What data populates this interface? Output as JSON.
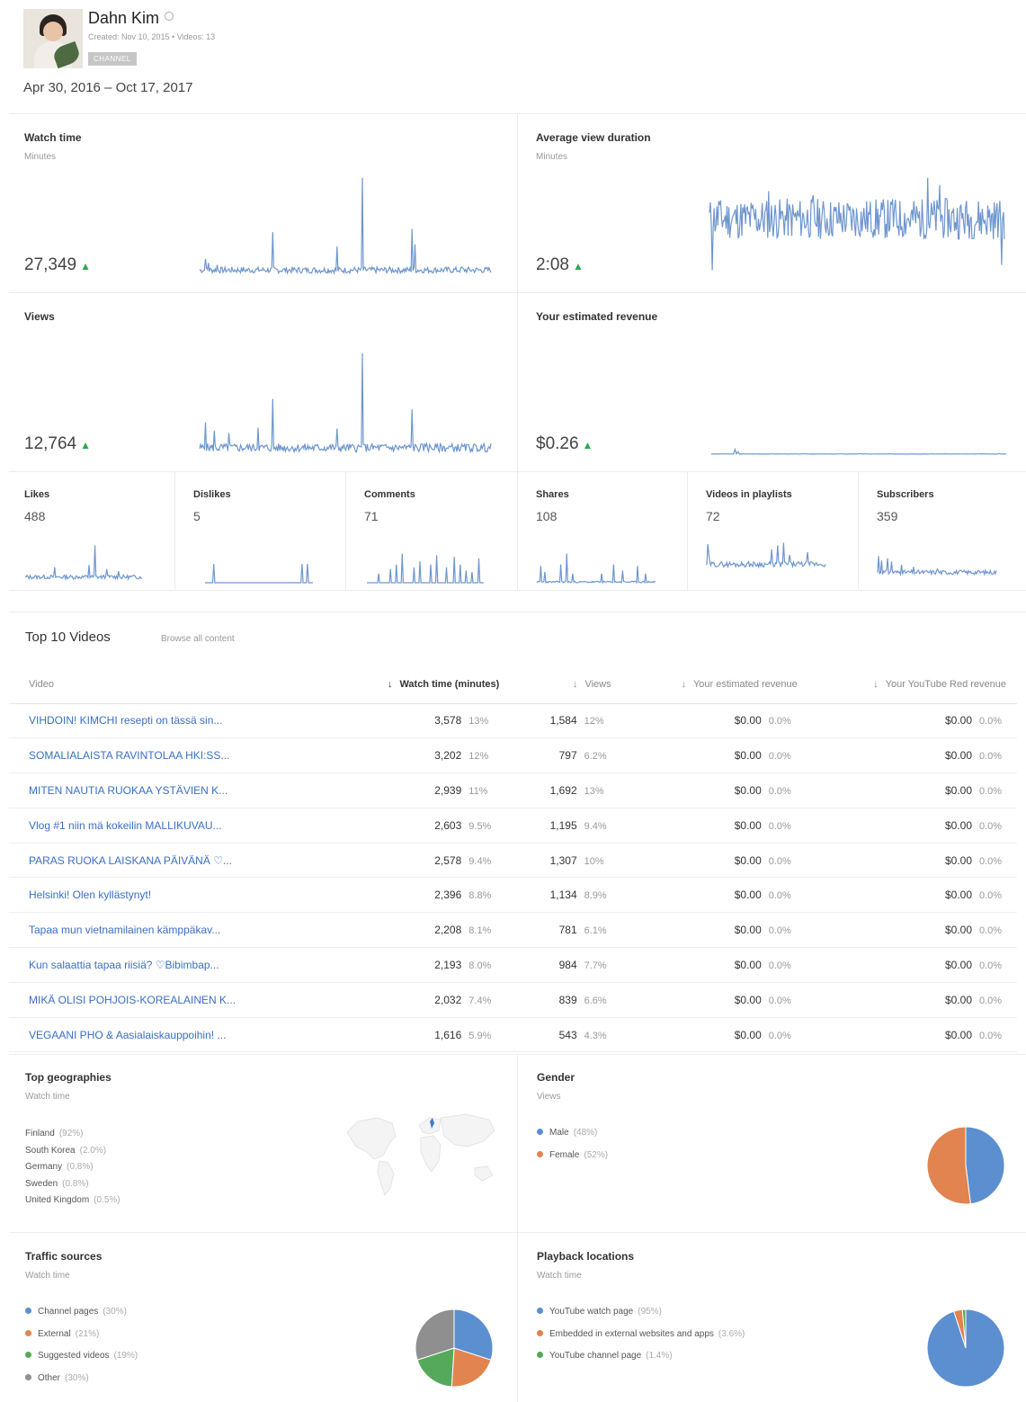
{
  "channel": {
    "name": "Dahn Kim",
    "meta": "Created: Nov 10, 2015  •  Videos: 13",
    "badge": "CHANNEL",
    "date_range": "Apr 30, 2016 – Oct 17, 2017"
  },
  "metrics": {
    "watch_time": {
      "title": "Watch time",
      "sub": "Minutes",
      "value": "27,349"
    },
    "avg_view_duration": {
      "title": "Average view duration",
      "sub": "Minutes",
      "value": "2:08"
    },
    "views": {
      "title": "Views",
      "value": "12,764"
    },
    "revenue": {
      "title": "Your estimated revenue",
      "value": "$0.26"
    }
  },
  "small_metrics": [
    {
      "title": "Likes",
      "value": "488"
    },
    {
      "title": "Dislikes",
      "value": "5"
    },
    {
      "title": "Comments",
      "value": "71"
    },
    {
      "title": "Shares",
      "value": "108"
    },
    {
      "title": "Videos in playlists",
      "value": "72"
    },
    {
      "title": "Subscribers",
      "value": "359"
    }
  ],
  "top_videos": {
    "title": "Top 10 Videos",
    "browse": "Browse all content",
    "headers": [
      "Video",
      "Watch time (minutes)",
      "Views",
      "Your estimated revenue",
      "Your YouTube Red revenue"
    ],
    "rows": [
      {
        "video": "VIHDOIN! KIMCHI resepti on tässä sin...",
        "watch": "3,578",
        "watch_pct": "13%",
        "views": "1,584",
        "views_pct": "12%",
        "rev": "$0.00",
        "rev_pct": "0.0%",
        "red": "$0.00",
        "red_pct": "0.0%"
      },
      {
        "video": "SOMALIALAISTA RAVINTOLAA HKI:SS...",
        "watch": "3,202",
        "watch_pct": "12%",
        "views": "797",
        "views_pct": "6.2%",
        "rev": "$0.00",
        "rev_pct": "0.0%",
        "red": "$0.00",
        "red_pct": "0.0%"
      },
      {
        "video": "MITEN NAUTIA RUOKAA YSTÄVIEN K...",
        "watch": "2,939",
        "watch_pct": "11%",
        "views": "1,692",
        "views_pct": "13%",
        "rev": "$0.00",
        "rev_pct": "0.0%",
        "red": "$0.00",
        "red_pct": "0.0%"
      },
      {
        "video": "Vlog #1 niin mä kokeilin MALLIKUVAU...",
        "watch": "2,603",
        "watch_pct": "9.5%",
        "views": "1,195",
        "views_pct": "9.4%",
        "rev": "$0.00",
        "rev_pct": "0.0%",
        "red": "$0.00",
        "red_pct": "0.0%"
      },
      {
        "video": "PARAS RUOKA LAISKANA PÄIVÄNÄ ♡...",
        "watch": "2,578",
        "watch_pct": "9.4%",
        "views": "1,307",
        "views_pct": "10%",
        "rev": "$0.00",
        "rev_pct": "0.0%",
        "red": "$0.00",
        "red_pct": "0.0%"
      },
      {
        "video": "Helsinki! Olen kyllästynyt!",
        "watch": "2,396",
        "watch_pct": "8.8%",
        "views": "1,134",
        "views_pct": "8.9%",
        "rev": "$0.00",
        "rev_pct": "0.0%",
        "red": "$0.00",
        "red_pct": "0.0%"
      },
      {
        "video": "Tapaa mun vietnamilainen kämppäkav...",
        "watch": "2,208",
        "watch_pct": "8.1%",
        "views": "781",
        "views_pct": "6.1%",
        "rev": "$0.00",
        "rev_pct": "0.0%",
        "red": "$0.00",
        "red_pct": "0.0%"
      },
      {
        "video": "Kun salaattia tapaa riisiä? ♡Bibimbap...",
        "watch": "2,193",
        "watch_pct": "8.0%",
        "views": "984",
        "views_pct": "7.7%",
        "rev": "$0.00",
        "rev_pct": "0.0%",
        "red": "$0.00",
        "red_pct": "0.0%"
      },
      {
        "video": "MIKÄ OLISI POHJOIS-KOREALAINEN K...",
        "watch": "2,032",
        "watch_pct": "7.4%",
        "views": "839",
        "views_pct": "6.6%",
        "rev": "$0.00",
        "rev_pct": "0.0%",
        "red": "$0.00",
        "red_pct": "0.0%"
      },
      {
        "video": "VEGAANI PHO & Aasialaiskauppoihin! ...",
        "watch": "1,616",
        "watch_pct": "5.9%",
        "views": "543",
        "views_pct": "4.3%",
        "rev": "$0.00",
        "rev_pct": "0.0%",
        "red": "$0.00",
        "red_pct": "0.0%"
      }
    ]
  },
  "geographies": {
    "title": "Top geographies",
    "sub": "Watch time",
    "items": [
      {
        "name": "Finland",
        "pct": "(92%)"
      },
      {
        "name": "South Korea",
        "pct": "(2.0%)"
      },
      {
        "name": "Germany",
        "pct": "(0.8%)"
      },
      {
        "name": "Sweden",
        "pct": "(0.8%)"
      },
      {
        "name": "United Kingdom",
        "pct": "(0.5%)"
      }
    ]
  },
  "gender": {
    "title": "Gender",
    "sub": "Views",
    "items": [
      {
        "name": "Male",
        "pct": "(48%)",
        "value": 48,
        "color": "#5b8fd0"
      },
      {
        "name": "Female",
        "pct": "(52%)",
        "value": 52,
        "color": "#e1844f"
      }
    ]
  },
  "traffic": {
    "title": "Traffic sources",
    "sub": "Watch time",
    "items": [
      {
        "name": "Channel pages",
        "pct": "(30%)",
        "value": 30,
        "color": "#5b8fd0"
      },
      {
        "name": "External",
        "pct": "(21%)",
        "value": 21,
        "color": "#e1844f"
      },
      {
        "name": "Suggested videos",
        "pct": "(19%)",
        "value": 19,
        "color": "#55a95a"
      },
      {
        "name": "Other",
        "pct": "(30%)",
        "value": 30,
        "color": "#8f8f8f"
      }
    ]
  },
  "playback": {
    "title": "Playback locations",
    "sub": "Watch time",
    "items": [
      {
        "name": "YouTube watch page",
        "pct": "(95%)",
        "value": 95,
        "color": "#5b8fd0"
      },
      {
        "name": "Embedded in external websites and apps",
        "pct": "(3.6%)",
        "value": 3.6,
        "color": "#e1844f"
      },
      {
        "name": "YouTube channel page",
        "pct": "(1.4%)",
        "value": 1.4,
        "color": "#55a95a"
      }
    ]
  },
  "chart_data": [
    {
      "type": "pie",
      "title": "Gender",
      "categories": [
        "Male",
        "Female"
      ],
      "values": [
        48,
        52
      ]
    },
    {
      "type": "pie",
      "title": "Traffic sources",
      "categories": [
        "Channel pages",
        "External",
        "Suggested videos",
        "Other"
      ],
      "values": [
        30,
        21,
        19,
        30
      ]
    },
    {
      "type": "pie",
      "title": "Playback locations",
      "categories": [
        "YouTube watch page",
        "Embedded in external websites and apps",
        "YouTube channel page"
      ],
      "values": [
        95,
        3.6,
        1.4
      ]
    }
  ]
}
